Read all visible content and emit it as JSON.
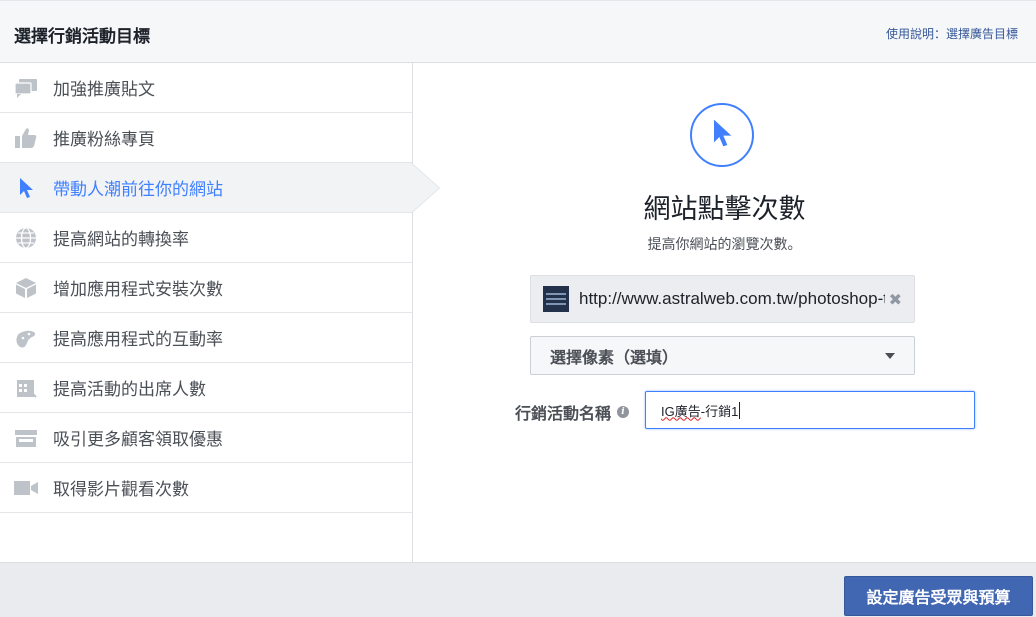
{
  "header": {
    "title": "選擇行銷活動目標",
    "help_link": "使用說明：選擇廣告目標"
  },
  "sidebar": {
    "items": [
      {
        "label": "加強推廣貼文",
        "icon": "speech-bubble-icon",
        "active": false
      },
      {
        "label": "推廣粉絲專頁",
        "icon": "thumbs-up-icon",
        "active": false
      },
      {
        "label": "帶動人潮前往你的網站",
        "icon": "cursor-icon",
        "active": true
      },
      {
        "label": "提高網站的轉換率",
        "icon": "globe-icon",
        "active": false
      },
      {
        "label": "增加應用程式安裝次數",
        "icon": "box-icon",
        "active": false
      },
      {
        "label": "提高應用程式的互動率",
        "icon": "gamepad-icon",
        "active": false
      },
      {
        "label": "提高活動的出席人數",
        "icon": "calendar-icon",
        "active": false
      },
      {
        "label": "吸引更多顧客領取優惠",
        "icon": "store-icon",
        "active": false
      },
      {
        "label": "取得影片觀看次數",
        "icon": "video-camera-icon",
        "active": false
      }
    ]
  },
  "objective": {
    "icon": "cursor-icon",
    "title": "網站點擊次數",
    "subtitle": "提高你網站的瀏覽次數。"
  },
  "url_field": {
    "value": "http://www.astralweb.com.tw/photoshop-te"
  },
  "pixel_select": {
    "selected": "選擇像素（選填）"
  },
  "campaign_name": {
    "label": "行銷活動名稱",
    "value_underlined": "IG廣告",
    "value_rest": "-行銷1"
  },
  "footer": {
    "continue_label": "設定廣告受眾與預算"
  },
  "colors": {
    "accent": "#4080ff",
    "button": "#4267b2",
    "icon_gray": "#bec3c9"
  }
}
